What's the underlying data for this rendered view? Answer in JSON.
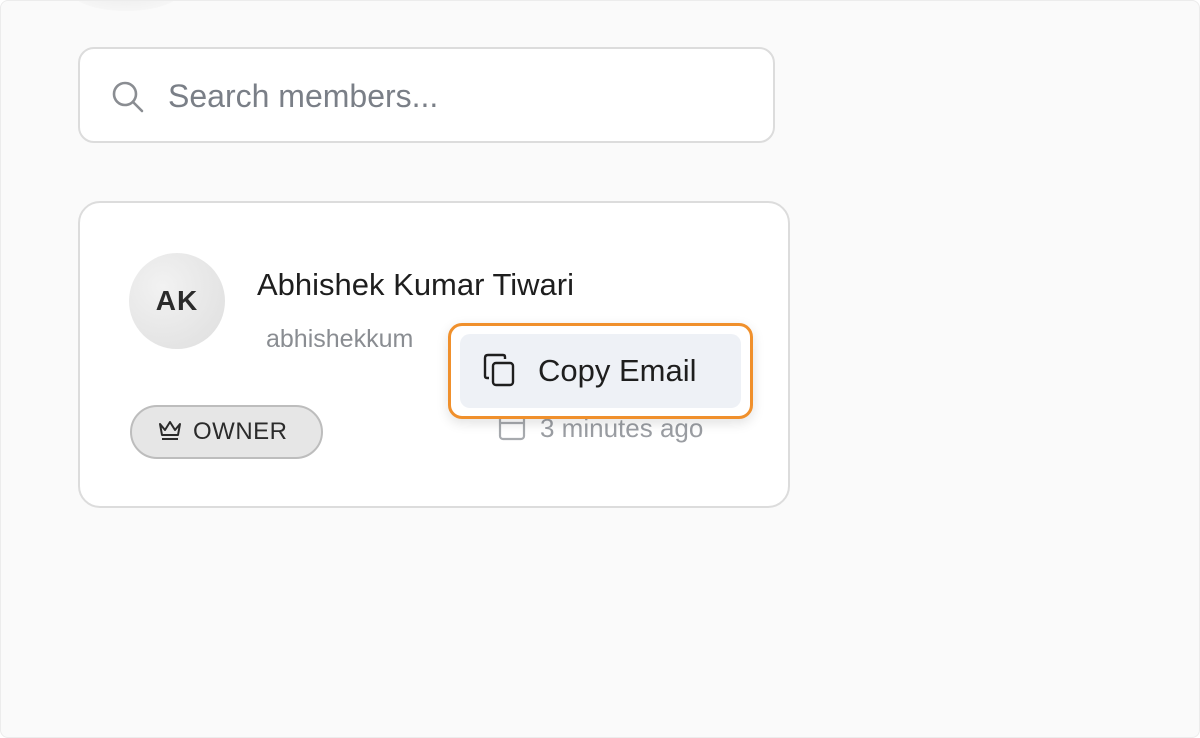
{
  "search": {
    "placeholder": "Search members...",
    "icon": "search-icon"
  },
  "member": {
    "initials": "AK",
    "name": "Abhishek Kumar Tiwari",
    "email": "abhishekkum",
    "role": "OWNER",
    "role_icon": "crown-icon",
    "joined": "3 minutes ago",
    "joined_icon": "calendar-icon"
  },
  "context_menu": {
    "copy_email_label": "Copy Email",
    "copy_icon": "copy-icon"
  },
  "colors": {
    "highlight": "#f0902c",
    "menu_item_bg": "#eef1f6",
    "badge_bg": "#e6e6e6"
  }
}
